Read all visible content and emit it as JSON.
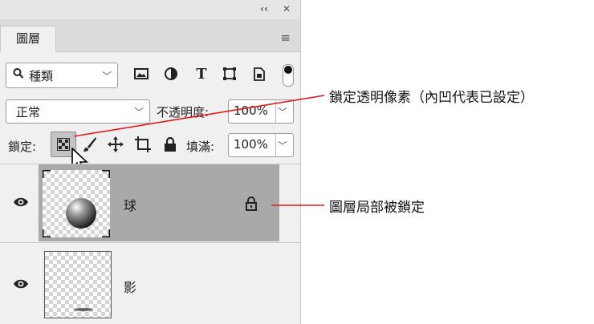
{
  "topbar": {
    "collapse": "‹‹",
    "close": "✕"
  },
  "tabs": [
    {
      "label": "圖層"
    }
  ],
  "filter": {
    "selected": "種類"
  },
  "blend_mode": {
    "selected": "正常"
  },
  "opacity": {
    "label": "不透明度:",
    "value": "100%"
  },
  "lock": {
    "label": "鎖定:"
  },
  "fill": {
    "label": "填滿:",
    "value": "100%"
  },
  "layers": [
    {
      "name": "球",
      "locked": true,
      "selected": true
    },
    {
      "name": "影",
      "locked": false,
      "selected": false
    }
  ],
  "annotations": {
    "lock_transparency": "鎖定透明像素（內凹代表已設定）",
    "layer_partially_locked": "圖層局部被鎖定"
  },
  "colors": {
    "panel": "#f0f0f0",
    "selected_row": "#a9a9a9",
    "annotation_line": "#e01b1b"
  }
}
